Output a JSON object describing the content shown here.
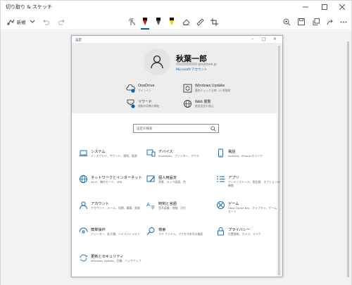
{
  "app": {
    "title": "切り取り & スケッチ",
    "new_label": "新規"
  },
  "settings": {
    "window_title": "設定",
    "user": {
      "name": "秋葉一郎",
      "email": "@outlook.jp",
      "account_link": "Microsoft アカウント"
    },
    "header_items": [
      {
        "name": "OneDrive",
        "sub": "サインイン",
        "icon": "cloud-icon"
      },
      {
        "name": "Windows Update",
        "sub": "最終チェック日時: 15 時間前",
        "icon": "update-icon"
      },
      {
        "name": "リワード",
        "sub": "報酬の収集の開始",
        "icon": "rewards-icon"
      },
      {
        "name": "Web 閲覧",
        "sub": "推奨設定の復元",
        "icon": "globe-icon"
      }
    ],
    "search_placeholder": "設定の検索",
    "categories": [
      {
        "name": "システム",
        "desc": "ディスプレイ、サウンド、通知、電源",
        "icon": "laptop-icon"
      },
      {
        "name": "デバイス",
        "desc": "Bluetooth、プリンター、マウス",
        "icon": "devices-icon"
      },
      {
        "name": "電話",
        "desc": "Android、iPhone のリンク",
        "icon": "phone-icon"
      },
      {
        "name": "ネットワークとインターネット",
        "desc": "Wi-Fi、機内モード、VPN",
        "icon": "network-globe-icon"
      },
      {
        "name": "個人用設定",
        "desc": "背景、ロック画面、色",
        "icon": "personalization-icon"
      },
      {
        "name": "アプリ",
        "desc": "アンインストール、既定値、オプションの機能",
        "icon": "apps-icon"
      },
      {
        "name": "アカウント",
        "desc": "アカウント、メール、同期、職場、家族",
        "icon": "account-icon"
      },
      {
        "name": "時刻と言語",
        "desc": "音声認識、地域、日付",
        "icon": "time-language-icon"
      },
      {
        "name": "ゲーム",
        "desc": "Xbox Game Bar、キャプチャ、ゲーム モード",
        "icon": "xbox-icon"
      },
      {
        "name": "簡単操作",
        "desc": "ナレーター、拡大鏡、ハイコントラスト",
        "icon": "ease-of-access-icon"
      },
      {
        "name": "検索",
        "desc": "マイ ファイル、アクセス許可の検索",
        "icon": "search-category-icon"
      },
      {
        "name": "プライバシー",
        "desc": "位置情報、カメラ、マイク",
        "icon": "privacy-lock-icon"
      },
      {
        "name": "更新とセキュリティ",
        "desc": "Windows Update、回復、バックアップ",
        "icon": "update-security-icon"
      }
    ]
  },
  "colors": {
    "accent": "#0063b1",
    "header_bg": "#ededed",
    "canvas_bg": "#f2f2f2"
  }
}
